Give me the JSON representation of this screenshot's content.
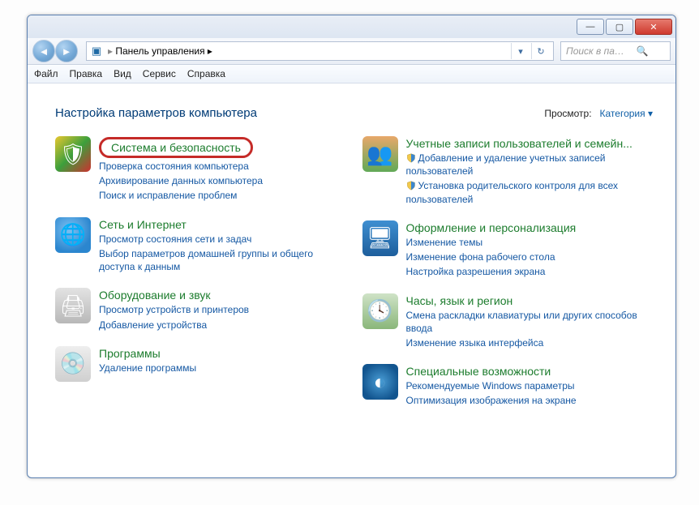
{
  "window": {
    "minimize_glyph": "—",
    "maximize_glyph": "▢",
    "close_glyph": "✕"
  },
  "nav": {
    "back_glyph": "◄",
    "fwd_glyph": "►",
    "breadcrumb": "Панель управления  ▸",
    "dropdown_glyph": "▾",
    "refresh_glyph": "↻"
  },
  "search": {
    "placeholder": "Поиск в па…",
    "icon_glyph": "🔍"
  },
  "menu": {
    "file": "Файл",
    "edit": "Правка",
    "view": "Вид",
    "tools": "Сервис",
    "help": "Справка"
  },
  "heading": "Настройка параметров компьютера",
  "view_by": {
    "label": "Просмотр:",
    "value": "Категория ▾"
  },
  "left": [
    {
      "title": "Система и безопасность",
      "highlight": true,
      "subs": [
        "Проверка состояния компьютера",
        "Архивирование данных компьютера",
        "Поиск и исправление проблем"
      ],
      "icon": "ic-shield",
      "glyph": "🛡"
    },
    {
      "title": "Сеть и Интернет",
      "subs": [
        "Просмотр состояния сети и задач",
        "Выбор параметров домашней группы и общего доступа к данным"
      ],
      "icon": "ic-net",
      "glyph": "🌐"
    },
    {
      "title": "Оборудование и звук",
      "subs": [
        "Просмотр устройств и принтеров",
        "Добавление устройства"
      ],
      "icon": "ic-hw",
      "glyph": "🖨"
    },
    {
      "title": "Программы",
      "subs": [
        "Удаление программы"
      ],
      "icon": "ic-prog",
      "glyph": "💿"
    }
  ],
  "right": [
    {
      "title": "Учетные записи пользователей и семейн...",
      "subs": [
        {
          "shield": true,
          "text": "Добавление и удаление учетных записей пользователей"
        },
        {
          "shield": true,
          "text": "Установка родительского контроля для всех пользователей"
        }
      ],
      "icon": "ic-users",
      "glyph": "👥"
    },
    {
      "title": "Оформление и персонализация",
      "subs": [
        "Изменение темы",
        "Изменение фона рабочего стола",
        "Настройка разрешения экрана"
      ],
      "icon": "ic-appear",
      "glyph": "🖥"
    },
    {
      "title": "Часы, язык и регион",
      "subs": [
        "Смена раскладки клавиатуры или других способов ввода",
        "Изменение языка интерфейса"
      ],
      "icon": "ic-clock",
      "glyph": "🕓"
    },
    {
      "title": "Специальные возможности",
      "subs": [
        "Рекомендуемые Windows параметры",
        "Оптимизация изображения на экране"
      ],
      "icon": "ic-acc",
      "glyph": "◐"
    }
  ]
}
